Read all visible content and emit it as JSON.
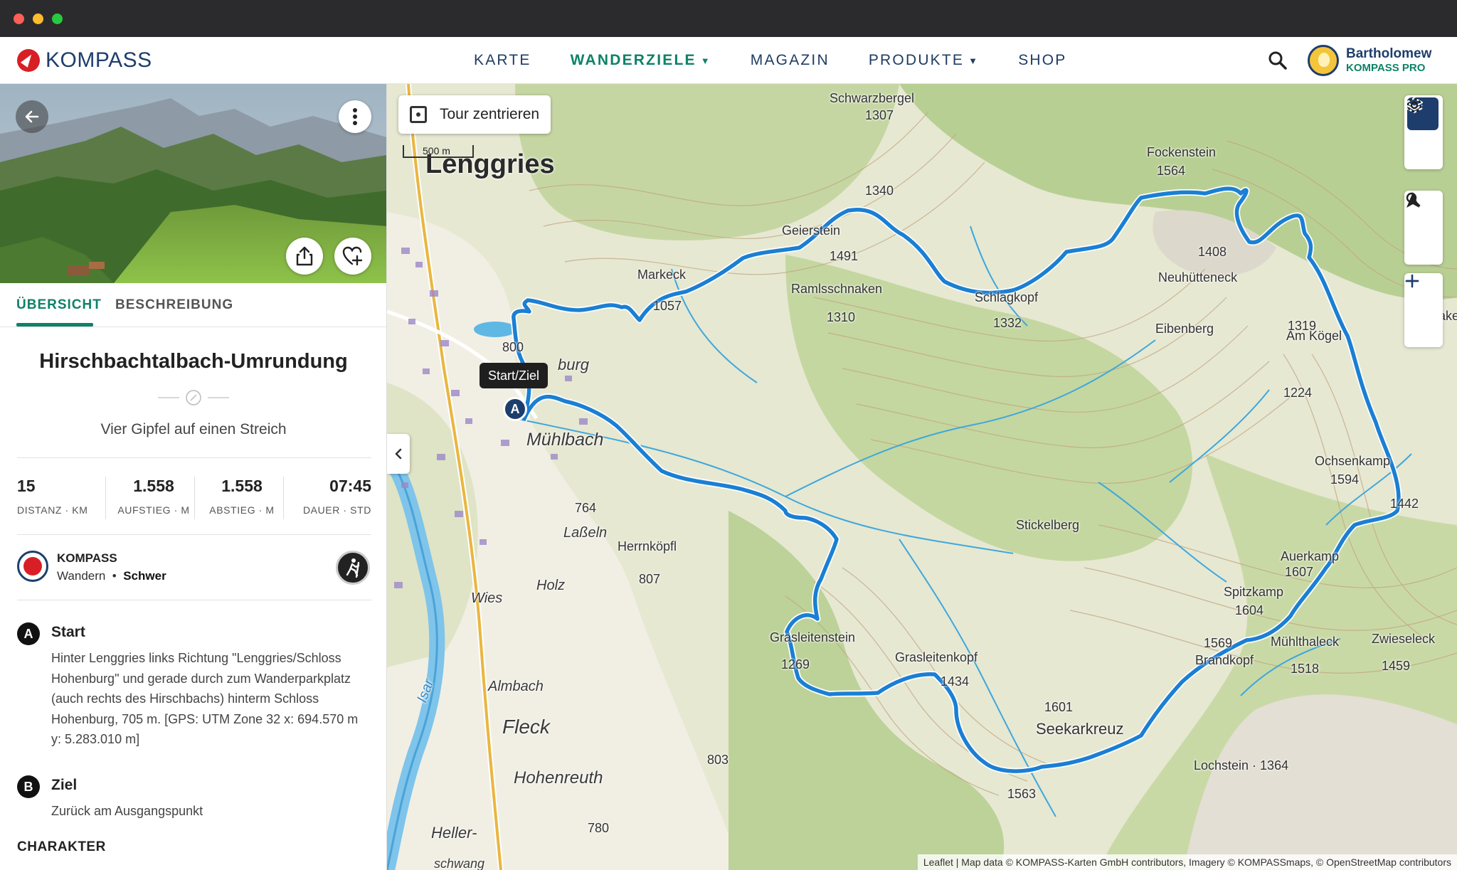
{
  "header": {
    "logo_text": "KOMPASS",
    "nav": [
      {
        "label": "KARTE",
        "active": false,
        "dropdown": false
      },
      {
        "label": "WANDERZIELE",
        "active": true,
        "dropdown": true
      },
      {
        "label": "MAGAZIN",
        "active": false,
        "dropdown": false
      },
      {
        "label": "PRODUKTE",
        "active": false,
        "dropdown": true
      },
      {
        "label": "SHOP",
        "active": false,
        "dropdown": false
      }
    ],
    "user": {
      "name": "Bartholomew",
      "plan": "KOMPASS PRO"
    }
  },
  "panel": {
    "tabs": [
      {
        "label": "ÜBERSICHT"
      },
      {
        "label": "BESCHREIBUNG"
      }
    ],
    "title": "Hirschbachtalbach-Umrundung",
    "subtitle": "Vier Gipfel auf einen Streich",
    "stats": [
      {
        "value": "15",
        "label": "DISTANZ · KM"
      },
      {
        "value": "1.558",
        "label": "AUFSTIEG · M"
      },
      {
        "value": "1.558",
        "label": "ABSTIEG · M"
      },
      {
        "value": "07:45",
        "label": "DAUER · STD"
      }
    ],
    "author": {
      "name": "KOMPASS",
      "activity": "Wandern",
      "difficulty": "Schwer"
    },
    "waypoints": [
      {
        "marker": "A",
        "title": "Start",
        "text": "Hinter Lenggries links Richtung \"Lenggries/Schloss Hohenburg\" und gerade durch zum Wanderparkplatz (auch rechts des Hirschbachs) hinterm Schloss Hohenburg, 705 m. [GPS: UTM Zone 32 x: 694.570 m y: 5.283.010 m]"
      },
      {
        "marker": "B",
        "title": "Ziel",
        "text": "Zurück am Ausgangspunkt"
      }
    ],
    "section": "CHARAKTER"
  },
  "map": {
    "center_button": "Tour zentrieren",
    "scale": "500 m",
    "tooltip": "Start/Ziel",
    "start_marker": "A",
    "attribution": "Leaflet | Map data © KOMPASS-Karten GmbH contributors, Imagery © KOMPASSmaps, © OpenStreetMap contributors",
    "labels": {
      "lenggries": "Lenggries",
      "schwarzbergel": "Schwarzbergel",
      "schwarzbergel_h": "1307",
      "h1340": "1340",
      "geierstein": "Geierstein",
      "geierstein_h": "1491",
      "fockenstein": "Fockenstein",
      "fockenstein_h": "1564",
      "markeck": "Markeck",
      "h1057": "1057",
      "ramlsschnaken": "Ramlsschnaken",
      "ramlsschnaken_h": "1310",
      "schlagkopf": "Schlagkopf",
      "schlagkopf_h": "1332",
      "neuhuetteneck": "Neuhütteneck",
      "neuhuetteneck_h": "1408",
      "eibenberg": "Eibenberg",
      "amkoegel": "Am Kögel",
      "amkoegel_h": "1319",
      "h800": "800",
      "burg": "burg",
      "muehlbach": "Mühlbach",
      "h1224": "1224",
      "ochsenkamp": "Ochsenkamp",
      "ochsenkamp_h": "1594",
      "h1442": "1442",
      "h764": "764",
      "lasseln": "Laßeln",
      "herrnkoepfl": "Herrnköpfl",
      "herrnkoepfl_h": "807",
      "stickelberg": "Stickelberg",
      "auerkamp": "Auerkamp",
      "auerkamp_h": "1607",
      "holz": "Holz",
      "wies": "Wies",
      "spitzkamp": "Spitzkamp",
      "spitzkamp_h": "1604",
      "grasleitenstein": "Grasleitenstein",
      "grasleitenstein_h": "1269",
      "grasleitenkopf": "Grasleitenkopf",
      "grasleitenkopf_h": "1434",
      "h1569": "1569",
      "brandkopf": "Brandkopf",
      "muehlthaleck": "Mühlthaleck",
      "muehlthaleck_h": "1518",
      "zwieseleck": "Zwieseleck",
      "zwieseleck_h": "1459",
      "almbach": "Almbach",
      "isar": "Isar",
      "fleck": "Fleck",
      "h1601": "1601",
      "seekarkreuz": "Seekarkreuz",
      "lochstein": "Lochstein · 1364",
      "h803": "803",
      "hohenreuth": "Hohenreuth",
      "h1563": "1563",
      "h780": "780",
      "heller": "Heller-",
      "schwang": "schwang",
      "ake": "ake"
    }
  }
}
